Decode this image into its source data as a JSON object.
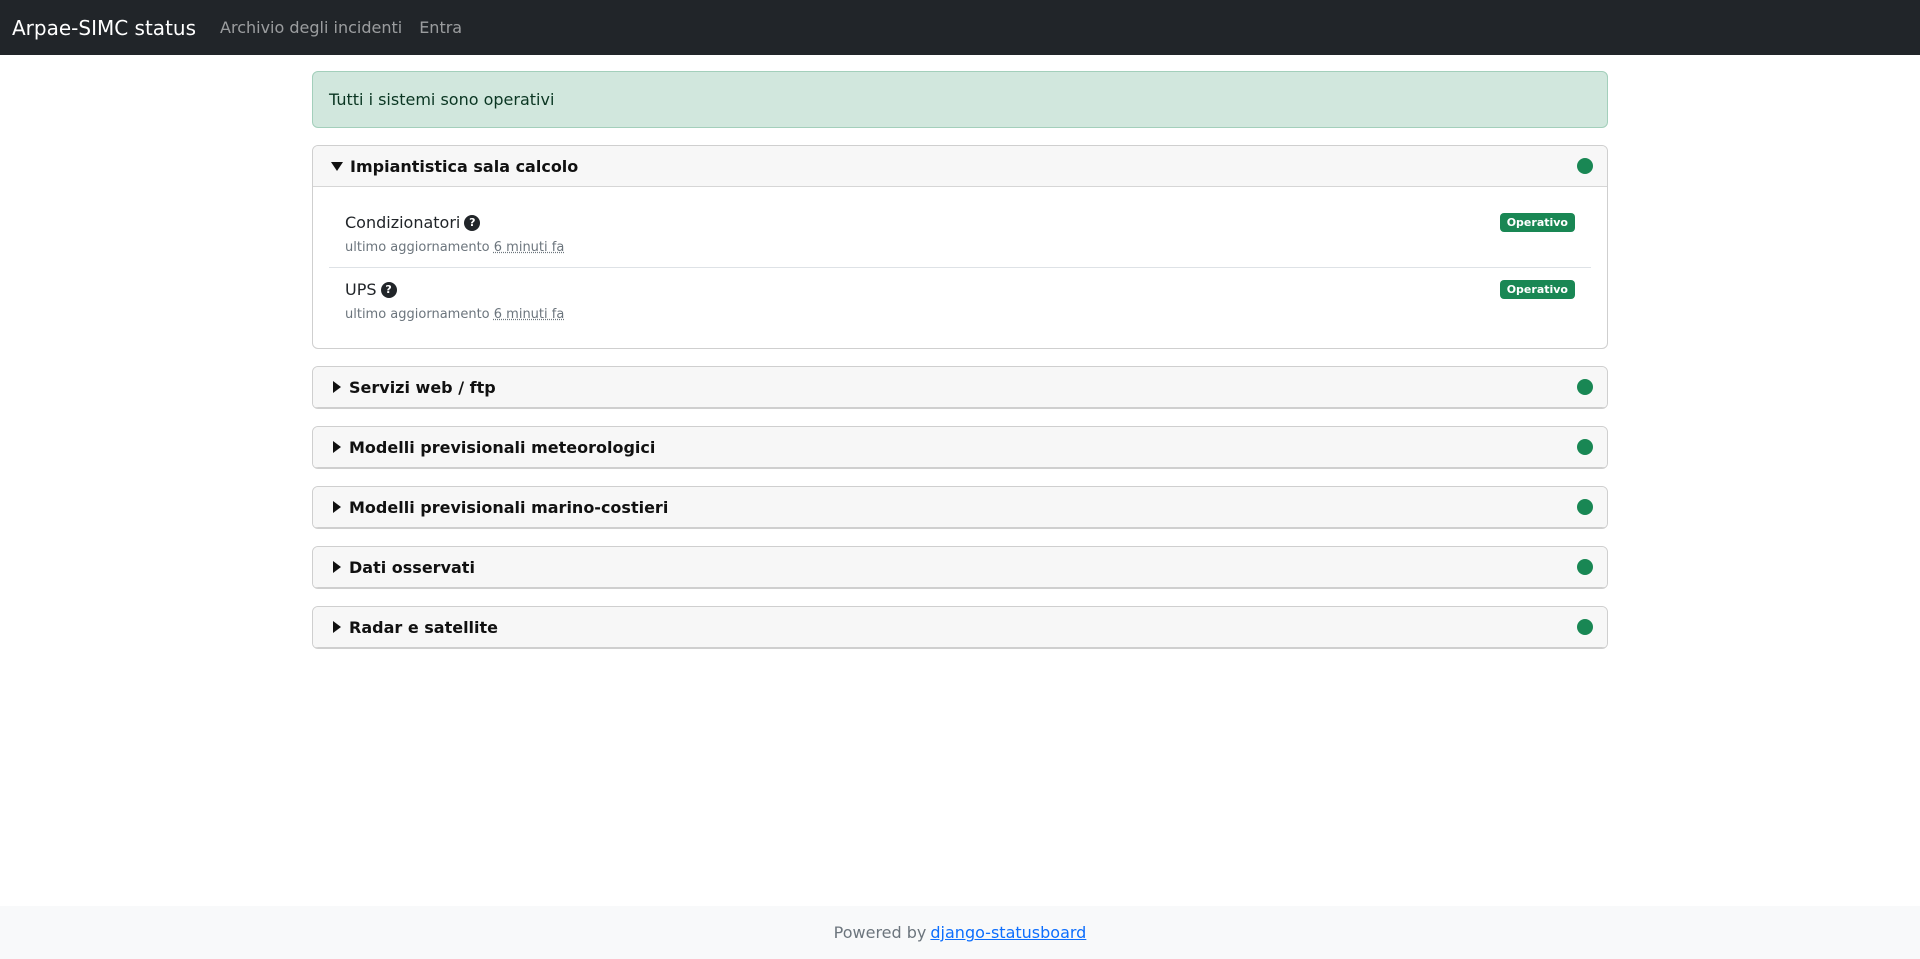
{
  "navbar": {
    "brand": "Arpae-SIMC status",
    "links": [
      "Archivio degli incidenti",
      "Entra"
    ]
  },
  "alert": {
    "text": "Tutti i sistemi sono operativi",
    "color": "#d1e7dd"
  },
  "groups": [
    {
      "title": "Impiantistica sala calcolo",
      "expanded": true,
      "status_color": "#198754",
      "items": [
        {
          "name": "Condizionatori",
          "help_icon": "question-circle-icon",
          "meta_prefix": "ultimo aggiornamento",
          "time": "6 minuti fa",
          "badge": "Operativo"
        },
        {
          "name": "UPS",
          "help_icon": "question-circle-icon",
          "meta_prefix": "ultimo aggiornamento",
          "time": "6 minuti fa",
          "badge": "Operativo"
        }
      ]
    },
    {
      "title": "Servizi web / ftp",
      "expanded": false,
      "status_color": "#198754"
    },
    {
      "title": "Modelli previsionali meteorologici",
      "expanded": false,
      "status_color": "#198754"
    },
    {
      "title": "Modelli previsionali marino-costieri",
      "expanded": false,
      "status_color": "#198754"
    },
    {
      "title": "Dati osservati",
      "expanded": false,
      "status_color": "#198754"
    },
    {
      "title": "Radar e satellite",
      "expanded": false,
      "status_color": "#198754"
    }
  ],
  "footer": {
    "prefix": "Powered by",
    "link": "django-statusboard"
  }
}
